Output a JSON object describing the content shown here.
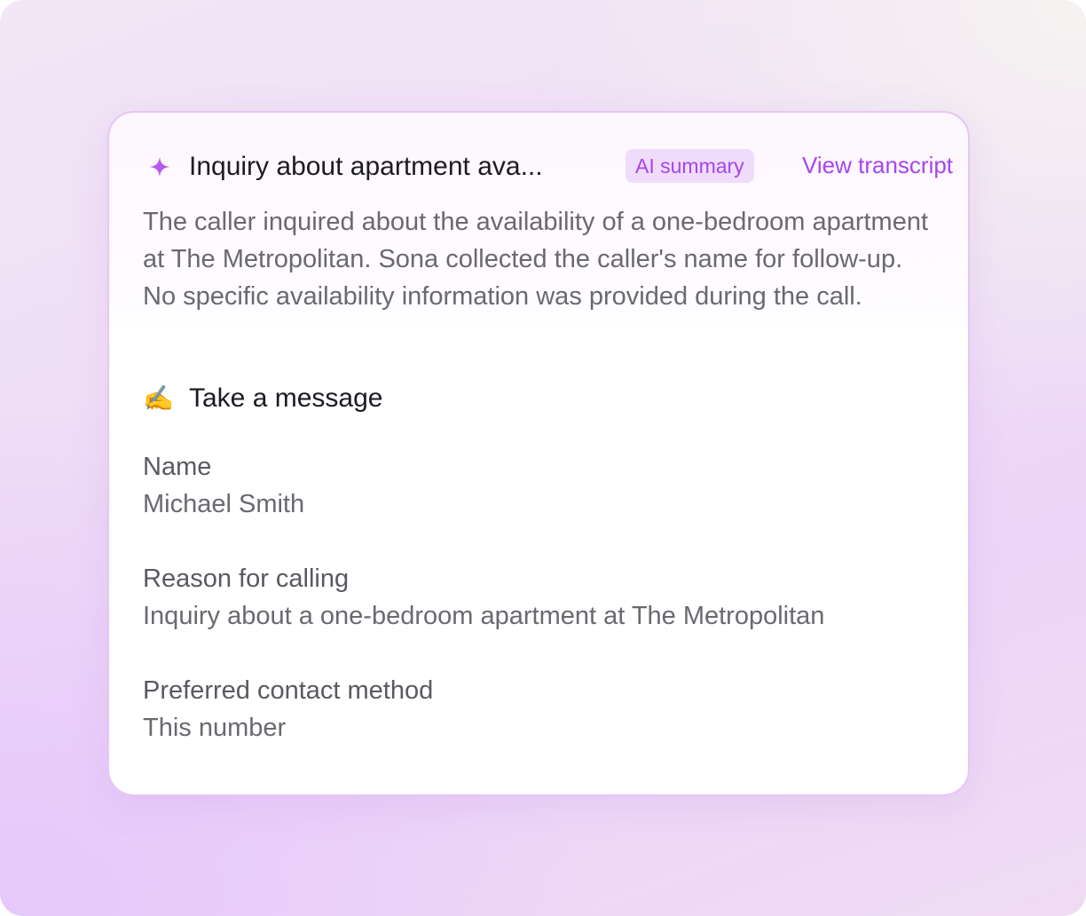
{
  "card": {
    "title": "Inquiry about apartment ava...",
    "badge": "AI summary",
    "transcript_link": "View transcript",
    "summary": "The caller inquired about the availability of a one-bedroom apartment at The Metropolitan. Sona collected the caller's name for follow-up. No specific availability information was provided during the call."
  },
  "section": {
    "icon": "✍️",
    "title": "Take a message"
  },
  "fields": [
    {
      "label": "Name",
      "value": "Michael Smith"
    },
    {
      "label": "Reason for calling",
      "value": "Inquiry about a one-bedroom apartment at The Metropolitan"
    },
    {
      "label": "Preferred contact method",
      "value": "This number"
    }
  ],
  "colors": {
    "accent": "#a844ee",
    "badge_bg": "#efdcfb",
    "card_border": "#e6c6f6"
  },
  "icons": {
    "header": "sparkle-icon",
    "section": "writing-hand-icon"
  }
}
